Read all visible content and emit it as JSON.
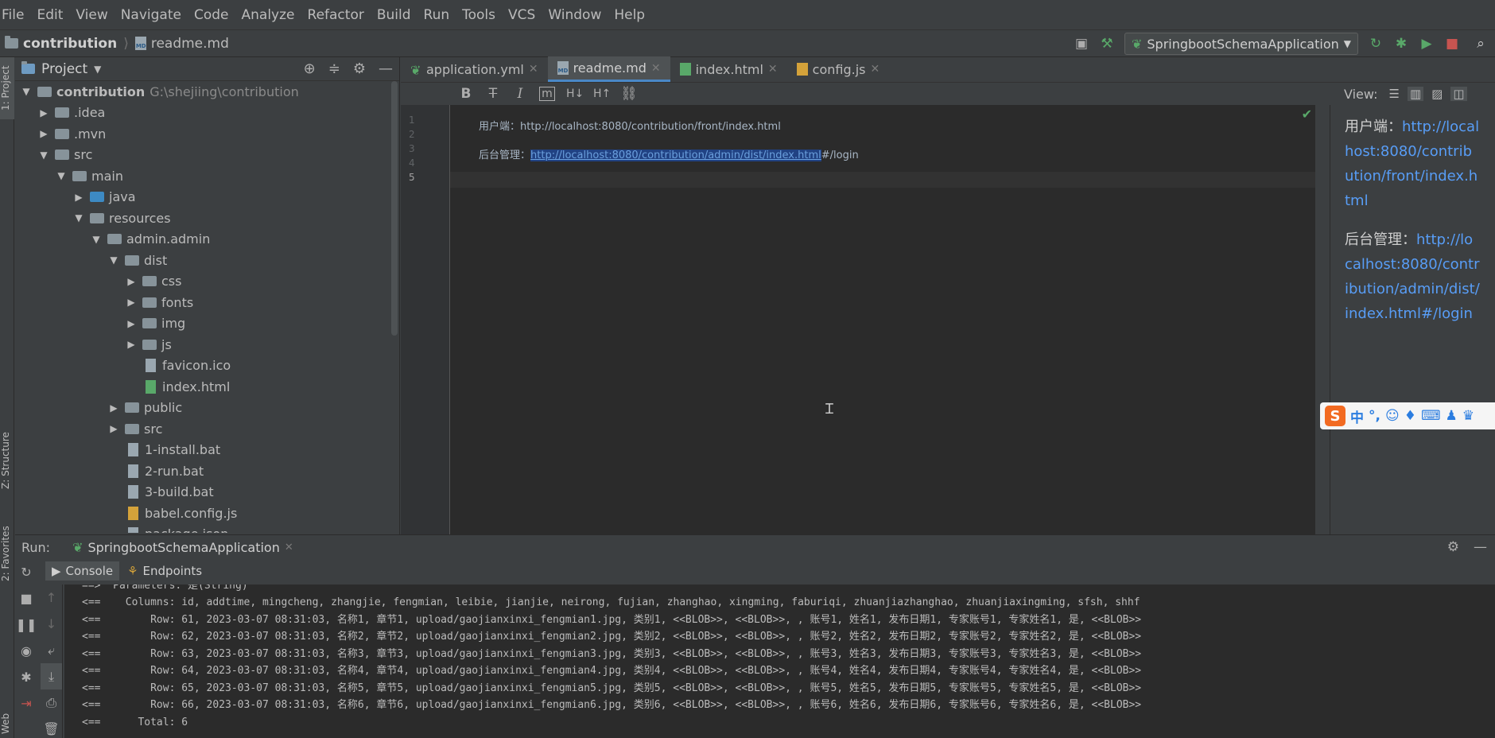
{
  "menu": [
    "File",
    "Edit",
    "View",
    "Navigate",
    "Code",
    "Analyze",
    "Refactor",
    "Build",
    "Run",
    "Tools",
    "VCS",
    "Window",
    "Help"
  ],
  "breadcrumb": {
    "project": "contribution",
    "file": "readme.md"
  },
  "run_config": {
    "name": "SpringbootSchemaApplication"
  },
  "left_stripe": {
    "project": "1: Project",
    "structure": "Z: Structure",
    "favorites": "2: Favorites",
    "web": "Web"
  },
  "project_panel": {
    "title": "Project",
    "tree": [
      {
        "label": "contribution",
        "path": "G:\\shejiing\\contribution",
        "depth": 0,
        "expanded": true,
        "kind": "root"
      },
      {
        "label": ".idea",
        "depth": 1,
        "expanded": false,
        "kind": "folder"
      },
      {
        "label": ".mvn",
        "depth": 1,
        "expanded": false,
        "kind": "folder"
      },
      {
        "label": "src",
        "depth": 1,
        "expanded": true,
        "kind": "folder"
      },
      {
        "label": "main",
        "depth": 2,
        "expanded": true,
        "kind": "folder"
      },
      {
        "label": "java",
        "depth": 3,
        "expanded": false,
        "kind": "folder-blue"
      },
      {
        "label": "resources",
        "depth": 3,
        "expanded": true,
        "kind": "folder"
      },
      {
        "label": "admin.admin",
        "depth": 4,
        "expanded": true,
        "kind": "folder"
      },
      {
        "label": "dist",
        "depth": 5,
        "expanded": true,
        "kind": "folder"
      },
      {
        "label": "css",
        "depth": 6,
        "expanded": false,
        "kind": "folder"
      },
      {
        "label": "fonts",
        "depth": 6,
        "expanded": false,
        "kind": "folder"
      },
      {
        "label": "img",
        "depth": 6,
        "expanded": false,
        "kind": "folder"
      },
      {
        "label": "js",
        "depth": 6,
        "expanded": false,
        "kind": "folder"
      },
      {
        "label": "favicon.ico",
        "depth": 6,
        "kind": "file"
      },
      {
        "label": "index.html",
        "depth": 6,
        "kind": "file-html"
      },
      {
        "label": "public",
        "depth": 5,
        "expanded": false,
        "kind": "folder"
      },
      {
        "label": "src",
        "depth": 5,
        "expanded": false,
        "kind": "folder"
      },
      {
        "label": "1-install.bat",
        "depth": 5,
        "kind": "file"
      },
      {
        "label": "2-run.bat",
        "depth": 5,
        "kind": "file"
      },
      {
        "label": "3-build.bat",
        "depth": 5,
        "kind": "file"
      },
      {
        "label": "babel.config.js",
        "depth": 5,
        "kind": "file-js"
      },
      {
        "label": "package.json",
        "depth": 5,
        "kind": "file"
      }
    ]
  },
  "editor_tabs": [
    {
      "label": "application.yml",
      "active": false,
      "icon": "yml"
    },
    {
      "label": "readme.md",
      "active": true,
      "icon": "md"
    },
    {
      "label": "index.html",
      "active": false,
      "icon": "html"
    },
    {
      "label": "config.js",
      "active": false,
      "icon": "js"
    }
  ],
  "md_toolbar": {
    "bold": "B",
    "strike": "T",
    "italic": "I",
    "code": "m",
    "h_decrease": "H↓",
    "h_increase": "H↑",
    "link": "🔗"
  },
  "editor": {
    "line_numbers": [
      "1",
      "2",
      "3",
      "4",
      "5"
    ],
    "lines": {
      "l3": "用户端：http://localhost:8080/contribution/front/index.html",
      "l5_prefix": "后台管理：",
      "l5_selected": "http://localhost:8080/contribution/admin/dist/index.html",
      "l5_suffix": "#/login"
    }
  },
  "preview": {
    "view_label": "View:",
    "p1_label": "用户端：",
    "p1_link": "http://localhost:8080/contribution/front/index.html",
    "p2_label": "后台管理：",
    "p2_link": "http://localhost:8080/contribution/admin/dist/index.html#/login"
  },
  "ime": {
    "logo": "S",
    "mode": "中",
    "punct": "°,"
  },
  "run_panel": {
    "label": "Run:",
    "tab": "SpringbootSchemaApplication",
    "console_tabs": [
      "Console",
      "Endpoints"
    ],
    "lines": [
      "==>  Parameters: 是(String)",
      "<==    Columns: id, addtime, mingcheng, zhangjie, fengmian, leibie, jianjie, neirong, fujian, zhanghao, xingming, faburiqi, zhuanjiazhanghao, zhuanjiaxingming, sfsh, shhf",
      "<==        Row: 61, 2023-03-07 08:31:03, 名称1, 章节1, upload/gaojianxinxi_fengmian1.jpg, 类别1, <<BLOB>>, <<BLOB>>, , 账号1, 姓名1, 发布日期1, 专家账号1, 专家姓名1, 是, <<BLOB>>",
      "<==        Row: 62, 2023-03-07 08:31:03, 名称2, 章节2, upload/gaojianxinxi_fengmian2.jpg, 类别2, <<BLOB>>, <<BLOB>>, , 账号2, 姓名2, 发布日期2, 专家账号2, 专家姓名2, 是, <<BLOB>>",
      "<==        Row: 63, 2023-03-07 08:31:03, 名称3, 章节3, upload/gaojianxinxi_fengmian3.jpg, 类别3, <<BLOB>>, <<BLOB>>, , 账号3, 姓名3, 发布日期3, 专家账号3, 专家姓名3, 是, <<BLOB>>",
      "<==        Row: 64, 2023-03-07 08:31:03, 名称4, 章节4, upload/gaojianxinxi_fengmian4.jpg, 类别4, <<BLOB>>, <<BLOB>>, , 账号4, 姓名4, 发布日期4, 专家账号4, 专家姓名4, 是, <<BLOB>>",
      "<==        Row: 65, 2023-03-07 08:31:03, 名称5, 章节5, upload/gaojianxinxi_fengmian5.jpg, 类别5, <<BLOB>>, <<BLOB>>, , 账号5, 姓名5, 发布日期5, 专家账号5, 专家姓名5, 是, <<BLOB>>",
      "<==        Row: 66, 2023-03-07 08:31:03, 名称6, 章节6, upload/gaojianxinxi_fengmian6.jpg, 类别6, <<BLOB>>, <<BLOB>>, , 账号6, 姓名6, 发布日期6, 专家账号6, 专家姓名6, 是, <<BLOB>>",
      "<==      Total: 6"
    ]
  },
  "colors": {
    "selection": "#214283",
    "link": "#589df6",
    "accent_tab": "#4a88c7",
    "run_green": "#59a869",
    "stop_red": "#c75450"
  }
}
